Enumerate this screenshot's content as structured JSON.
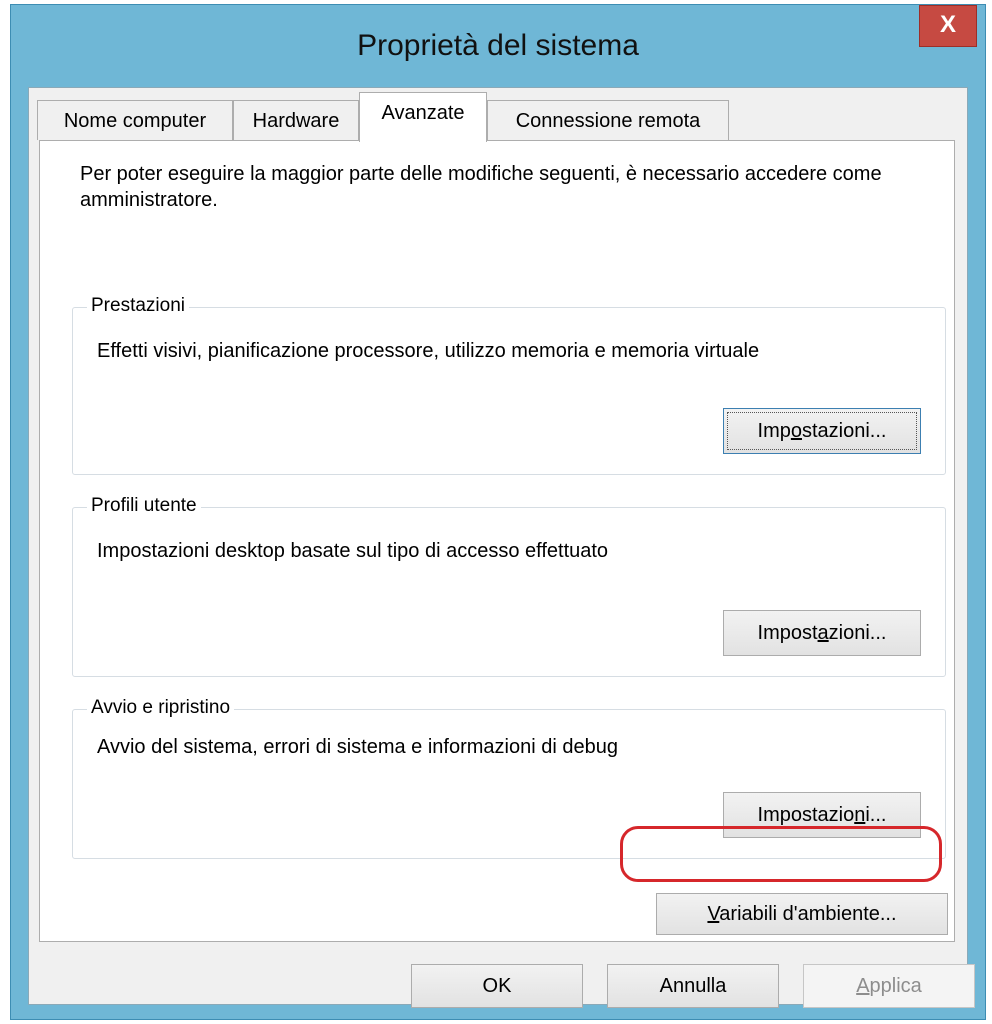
{
  "window": {
    "title": "Proprietà del sistema",
    "close_glyph": "X"
  },
  "tabs": [
    {
      "label": "Nome computer"
    },
    {
      "label": "Hardware"
    },
    {
      "label": "Avanzate"
    },
    {
      "label": "Connessione remota"
    }
  ],
  "active_tab": "Avanzate",
  "intro": "Per poter eseguire la maggior parte delle modifiche seguenti, è necessario accedere come amministratore.",
  "groups": [
    {
      "label": "Prestazioni",
      "description": "Effetti visivi, pianificazione processore, utilizzo memoria e memoria virtuale",
      "button": {
        "pre": "Imp",
        "key": "o",
        "post": "stazioni..."
      }
    },
    {
      "label": "Profili utente",
      "description": "Impostazioni desktop basate sul tipo di accesso effettuato",
      "button": {
        "pre": "Impost",
        "key": "a",
        "post": "zioni..."
      }
    },
    {
      "label": "Avvio e ripristino",
      "description": "Avvio del sistema, errori di sistema e informazioni di debug",
      "button": {
        "pre": "Impostazio",
        "key": "n",
        "post": "i..."
      }
    }
  ],
  "env_button": {
    "pre": "",
    "key": "V",
    "post": "ariabili d'ambiente..."
  },
  "footer": {
    "ok": "OK",
    "cancel": "Annulla",
    "apply": {
      "pre": "",
      "key": "A",
      "post": "pplica"
    }
  },
  "colors": {
    "frame": "#6fb7d6",
    "close": "#c64a42",
    "highlight": "#d6272b"
  }
}
